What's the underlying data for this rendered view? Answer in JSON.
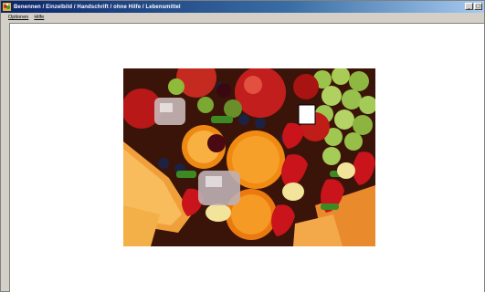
{
  "window": {
    "title": "Benennen / Einzelbild / Handschrift / ohne Hilfe / Lebensmittel",
    "icon": "app-icon",
    "buttons": {
      "minimize": "_",
      "maximize": "□"
    }
  },
  "menu": {
    "items": [
      {
        "label": "Optionen"
      },
      {
        "label": "Hilfe"
      }
    ]
  },
  "content": {
    "image": {
      "subject": "fruit-picture",
      "selection_marker": "white-square"
    }
  }
}
